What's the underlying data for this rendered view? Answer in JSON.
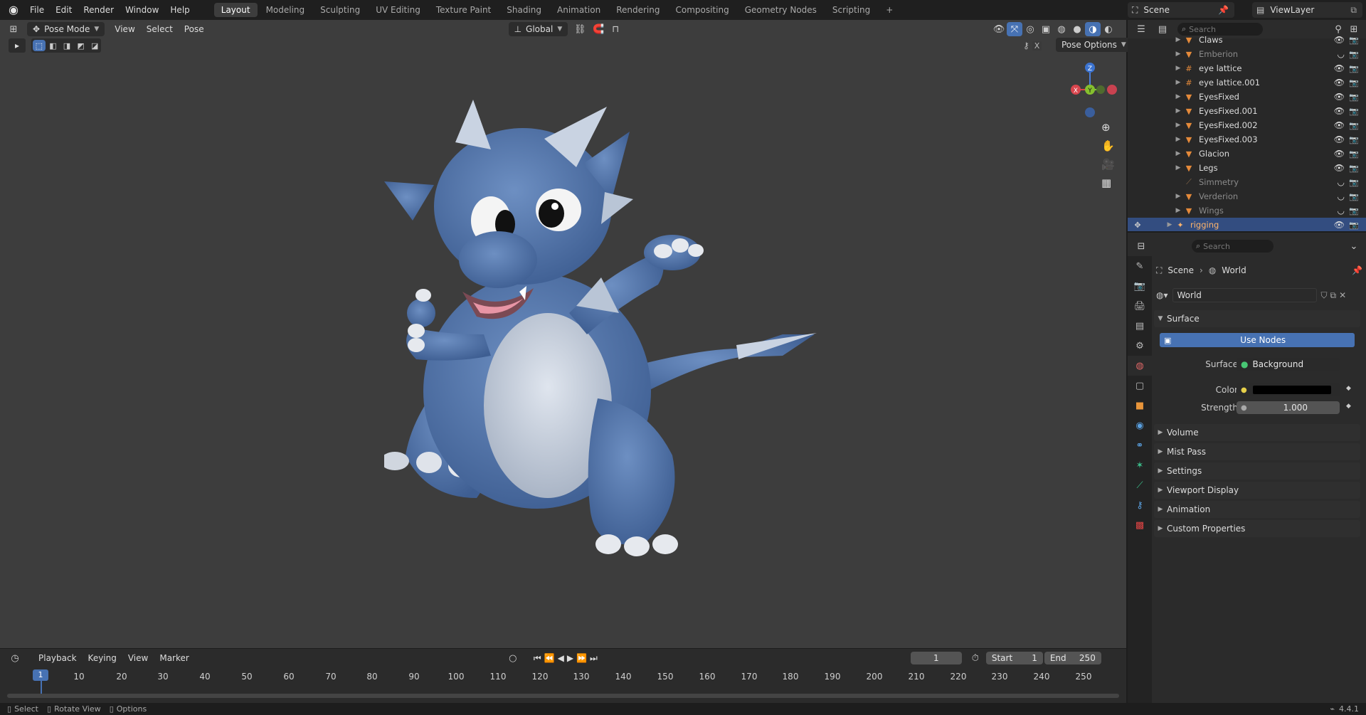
{
  "topbar": {
    "menus": [
      "File",
      "Edit",
      "Render",
      "Window",
      "Help"
    ],
    "workspaces": [
      "Layout",
      "Modeling",
      "Sculpting",
      "UV Editing",
      "Texture Paint",
      "Shading",
      "Animation",
      "Rendering",
      "Compositing",
      "Geometry Nodes",
      "Scripting"
    ],
    "active_workspace": "Layout",
    "add_tab": "+",
    "scene_name": "Scene",
    "view_layer": "ViewLayer"
  },
  "viewport_header": {
    "mode": "Pose Mode",
    "menus": [
      "View",
      "Select",
      "Pose"
    ],
    "transform_orientation": "Global",
    "pose_options": "Pose Options"
  },
  "gizmo": {
    "x": "X",
    "y": "Y",
    "z": "Z"
  },
  "outliner": {
    "search_placeholder": "Search",
    "rows": [
      {
        "name": "Claws",
        "dim": false
      },
      {
        "name": "Emberion",
        "dim": true
      },
      {
        "name": "eye lattice",
        "dim": false
      },
      {
        "name": "eye lattice.001",
        "dim": false
      },
      {
        "name": "EyesFixed",
        "dim": false
      },
      {
        "name": "EyesFixed.001",
        "dim": false
      },
      {
        "name": "EyesFixed.002",
        "dim": false
      },
      {
        "name": "EyesFixed.003",
        "dim": false
      },
      {
        "name": "Glacion",
        "dim": false
      },
      {
        "name": "Legs",
        "dim": false
      },
      {
        "name": "Simmetry",
        "dim": true
      },
      {
        "name": "Verderion",
        "dim": true
      },
      {
        "name": "Wings",
        "dim": true
      },
      {
        "name": "rigging",
        "dim": false
      }
    ]
  },
  "properties": {
    "search_placeholder": "Search",
    "breadcrumb": {
      "scene": "Scene",
      "world": "World"
    },
    "world_name": "World",
    "surface_panel": "Surface",
    "use_nodes": "Use Nodes",
    "surface_label": "Surface",
    "surface_value": "Background",
    "color_label": "Color",
    "strength_label": "Strength",
    "strength_value": "1.000",
    "color_swatch": "#000000",
    "collapsed_panels": [
      "Volume",
      "Mist Pass",
      "Settings",
      "Viewport Display",
      "Animation",
      "Custom Properties"
    ]
  },
  "timeline": {
    "menus": [
      "Playback",
      "Keying",
      "View",
      "Marker"
    ],
    "current_frame": "1",
    "start_label": "Start",
    "start": "1",
    "end_label": "End",
    "end": "250",
    "ticks": [
      "1",
      "10",
      "20",
      "30",
      "40",
      "50",
      "60",
      "70",
      "80",
      "90",
      "100",
      "110",
      "120",
      "130",
      "140",
      "150",
      "160",
      "170",
      "180",
      "190",
      "200",
      "210",
      "220",
      "230",
      "240",
      "250"
    ]
  },
  "statusbar": {
    "select": "Select",
    "rotate": "Rotate View",
    "options": "Options",
    "version": "4.4.1"
  },
  "colors": {
    "accent": "#4772b3",
    "viewport_bg": "#3d3d3d",
    "dragon_body": "#5677a8",
    "dragon_belly": "#c8d0dc"
  }
}
